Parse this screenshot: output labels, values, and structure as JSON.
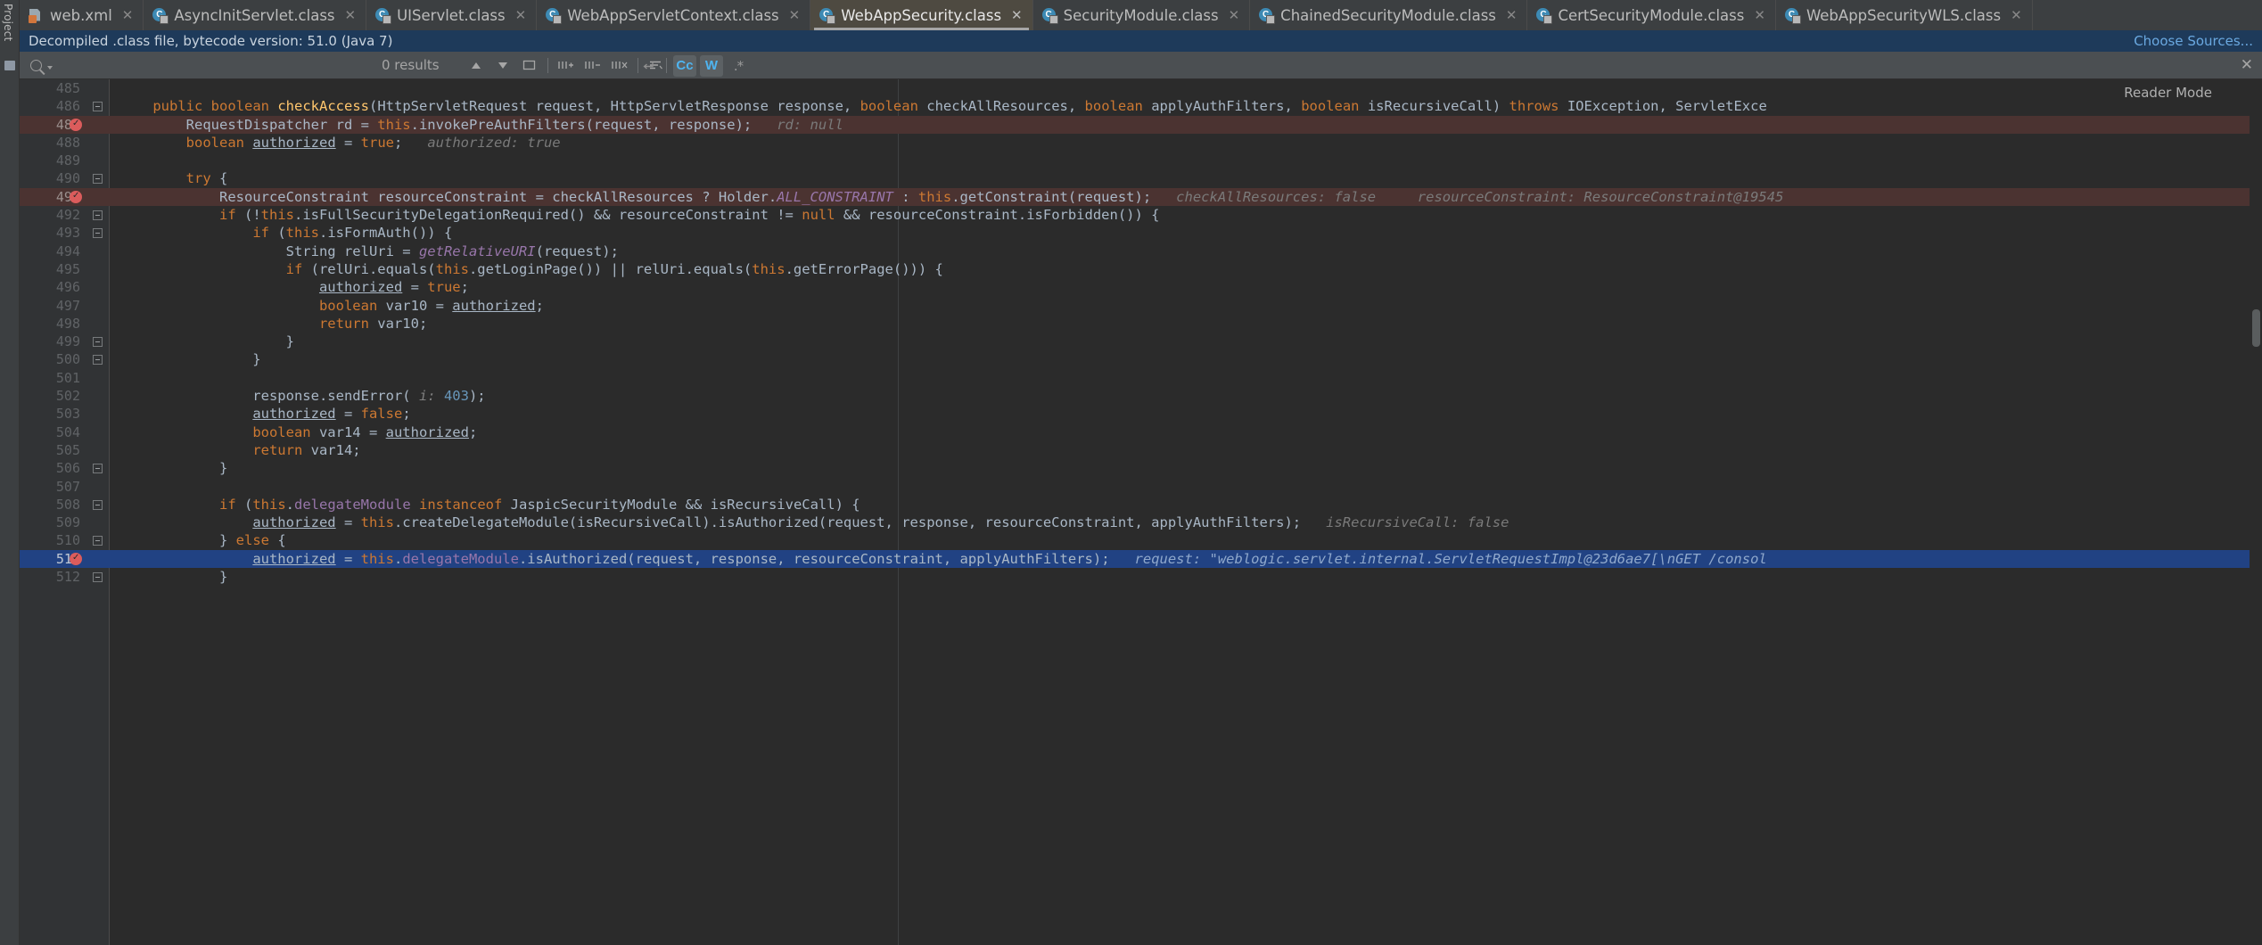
{
  "window": {
    "left_rail_label": "Project"
  },
  "tabs": [
    {
      "label": "web.xml",
      "icon": "xml-file-icon",
      "active": false
    },
    {
      "label": "AsyncInitServlet.class",
      "icon": "java-class-icon",
      "active": false
    },
    {
      "label": "UIServlet.class",
      "icon": "java-class-icon",
      "active": false
    },
    {
      "label": "WebAppServletContext.class",
      "icon": "java-class-icon",
      "active": false
    },
    {
      "label": "WebAppSecurity.class",
      "icon": "java-class-icon",
      "active": true
    },
    {
      "label": "SecurityModule.class",
      "icon": "java-class-icon",
      "active": false
    },
    {
      "label": "ChainedSecurityModule.class",
      "icon": "java-class-icon",
      "active": false
    },
    {
      "label": "CertSecurityModule.class",
      "icon": "java-class-icon",
      "active": false
    },
    {
      "label": "WebAppSecurityWLS.class",
      "icon": "java-class-icon",
      "active": false
    }
  ],
  "notification": {
    "message": "Decompiled .class file, bytecode version: 51.0 (Java 7)",
    "action_label": "Choose Sources...",
    "background": "#1e3a5a",
    "link_color": "#6aa8e0"
  },
  "findbar": {
    "search_value": "",
    "search_placeholder": "",
    "results_label": "0 results",
    "toggles": [
      {
        "name": "match-case",
        "label": "Cc",
        "on": true
      },
      {
        "name": "words",
        "label": "W",
        "on": true
      },
      {
        "name": "regex",
        "label": ".*",
        "on": false
      }
    ],
    "icons": [
      "new-line-icon",
      "prev-occurrence-icon",
      "next-occurrence-icon",
      "select-all-occurrences-icon",
      "add-selection-icon",
      "exclude-selection-icon",
      "exclude-all-icon",
      "filter-lines-icon",
      "filter-icon",
      "close-icon"
    ]
  },
  "editor": {
    "reader_mode_label": "Reader Mode",
    "accent_execution_line": "#4b3331",
    "accent_selected_line": "#214283",
    "breakpoint_color": "#db5c5c",
    "lines": [
      {
        "num": "485",
        "breakpoint": false,
        "fold": false,
        "state": "normal",
        "tokens": [
          {
            "t": "",
            "c": "id"
          }
        ]
      },
      {
        "num": "486",
        "breakpoint": false,
        "fold": true,
        "state": "normal",
        "tokens": [
          {
            "t": "    ",
            "c": "id"
          },
          {
            "t": "public",
            "c": "kw"
          },
          {
            "t": " ",
            "c": "id"
          },
          {
            "t": "boolean",
            "c": "kw"
          },
          {
            "t": " ",
            "c": "id"
          },
          {
            "t": "checkAccess",
            "c": "mth"
          },
          {
            "t": "(HttpServletRequest request, HttpServletResponse response, ",
            "c": "id"
          },
          {
            "t": "boolean",
            "c": "kw"
          },
          {
            "t": " checkAllResources, ",
            "c": "id"
          },
          {
            "t": "boolean",
            "c": "kw"
          },
          {
            "t": " applyAuthFilters, ",
            "c": "id"
          },
          {
            "t": "boolean",
            "c": "kw"
          },
          {
            "t": " isRecursiveCall) ",
            "c": "id"
          },
          {
            "t": "throws",
            "c": "kw"
          },
          {
            "t": " IOException, ServletExce",
            "c": "id"
          }
        ]
      },
      {
        "num": "487",
        "breakpoint": true,
        "fold": false,
        "state": "exec",
        "tokens": [
          {
            "t": "        RequestDispatcher rd = ",
            "c": "id"
          },
          {
            "t": "this",
            "c": "kw"
          },
          {
            "t": ".invokePreAuthFilters(request, response);",
            "c": "id"
          },
          {
            "t": "   rd: null",
            "c": "hint"
          }
        ]
      },
      {
        "num": "488",
        "breakpoint": false,
        "fold": false,
        "state": "normal",
        "tokens": [
          {
            "t": "        ",
            "c": "id"
          },
          {
            "t": "boolean",
            "c": "kw"
          },
          {
            "t": " ",
            "c": "id"
          },
          {
            "t": "authorized",
            "c": "und"
          },
          {
            "t": " = ",
            "c": "id"
          },
          {
            "t": "true",
            "c": "kw"
          },
          {
            "t": ";",
            "c": "id"
          },
          {
            "t": "   authorized: true",
            "c": "hint"
          }
        ]
      },
      {
        "num": "489",
        "breakpoint": false,
        "fold": false,
        "state": "normal",
        "tokens": [
          {
            "t": "",
            "c": "id"
          }
        ]
      },
      {
        "num": "490",
        "breakpoint": false,
        "fold": true,
        "state": "normal",
        "tokens": [
          {
            "t": "        ",
            "c": "id"
          },
          {
            "t": "try",
            "c": "kw"
          },
          {
            "t": " {",
            "c": "id"
          }
        ]
      },
      {
        "num": "491",
        "breakpoint": true,
        "fold": false,
        "state": "exec",
        "tokens": [
          {
            "t": "            ResourceConstraint resourceConstraint = checkAllResources ? Holder.",
            "c": "id"
          },
          {
            "t": "ALL_CONSTRAINT",
            "c": "const"
          },
          {
            "t": " : ",
            "c": "id"
          },
          {
            "t": "this",
            "c": "kw"
          },
          {
            "t": ".getConstraint(request);",
            "c": "id"
          },
          {
            "t": "   checkAllResources: false",
            "c": "hint"
          },
          {
            "t": "     resourceConstraint: ResourceConstraint@19545",
            "c": "hint"
          }
        ]
      },
      {
        "num": "492",
        "breakpoint": false,
        "fold": true,
        "state": "normal",
        "tokens": [
          {
            "t": "            ",
            "c": "id"
          },
          {
            "t": "if",
            "c": "kw"
          },
          {
            "t": " (!",
            "c": "id"
          },
          {
            "t": "this",
            "c": "kw"
          },
          {
            "t": ".isFullSecurityDelegationRequired() && resourceConstraint != ",
            "c": "id"
          },
          {
            "t": "null",
            "c": "kw"
          },
          {
            "t": " && resourceConstraint.isForbidden()) {",
            "c": "id"
          }
        ]
      },
      {
        "num": "493",
        "breakpoint": false,
        "fold": true,
        "state": "normal",
        "tokens": [
          {
            "t": "                ",
            "c": "id"
          },
          {
            "t": "if",
            "c": "kw"
          },
          {
            "t": " (",
            "c": "id"
          },
          {
            "t": "this",
            "c": "kw"
          },
          {
            "t": ".isFormAuth()) {",
            "c": "id"
          }
        ]
      },
      {
        "num": "494",
        "breakpoint": false,
        "fold": false,
        "state": "normal",
        "tokens": [
          {
            "t": "                    String relUri = ",
            "c": "id"
          },
          {
            "t": "getRelativeURI",
            "c": "stat"
          },
          {
            "t": "(request);",
            "c": "id"
          }
        ]
      },
      {
        "num": "495",
        "breakpoint": false,
        "fold": false,
        "state": "normal",
        "tokens": [
          {
            "t": "                    ",
            "c": "id"
          },
          {
            "t": "if",
            "c": "kw"
          },
          {
            "t": " (relUri.equals(",
            "c": "id"
          },
          {
            "t": "this",
            "c": "kw"
          },
          {
            "t": ".getLoginPage()) || relUri.equals(",
            "c": "id"
          },
          {
            "t": "this",
            "c": "kw"
          },
          {
            "t": ".getErrorPage())) {",
            "c": "id"
          }
        ]
      },
      {
        "num": "496",
        "breakpoint": false,
        "fold": false,
        "state": "normal",
        "tokens": [
          {
            "t": "                        ",
            "c": "id"
          },
          {
            "t": "authorized",
            "c": "und"
          },
          {
            "t": " = ",
            "c": "id"
          },
          {
            "t": "true",
            "c": "kw"
          },
          {
            "t": ";",
            "c": "id"
          }
        ]
      },
      {
        "num": "497",
        "breakpoint": false,
        "fold": false,
        "state": "normal",
        "tokens": [
          {
            "t": "                        ",
            "c": "id"
          },
          {
            "t": "boolean",
            "c": "kw"
          },
          {
            "t": " var10 = ",
            "c": "id"
          },
          {
            "t": "authorized",
            "c": "und"
          },
          {
            "t": ";",
            "c": "id"
          }
        ]
      },
      {
        "num": "498",
        "breakpoint": false,
        "fold": false,
        "state": "normal",
        "tokens": [
          {
            "t": "                        ",
            "c": "id"
          },
          {
            "t": "return",
            "c": "kw"
          },
          {
            "t": " var10;",
            "c": "id"
          }
        ]
      },
      {
        "num": "499",
        "breakpoint": false,
        "fold": true,
        "state": "normal",
        "tokens": [
          {
            "t": "                    }",
            "c": "id"
          }
        ]
      },
      {
        "num": "500",
        "breakpoint": false,
        "fold": true,
        "state": "normal",
        "tokens": [
          {
            "t": "                }",
            "c": "id"
          }
        ]
      },
      {
        "num": "501",
        "breakpoint": false,
        "fold": false,
        "state": "normal",
        "tokens": [
          {
            "t": "",
            "c": "id"
          }
        ]
      },
      {
        "num": "502",
        "breakpoint": false,
        "fold": false,
        "state": "normal",
        "tokens": [
          {
            "t": "                response.sendError( ",
            "c": "id"
          },
          {
            "t": "i:",
            "c": "hintv"
          },
          {
            "t": " ",
            "c": "id"
          },
          {
            "t": "403",
            "c": "num2"
          },
          {
            "t": ");",
            "c": "id"
          }
        ]
      },
      {
        "num": "503",
        "breakpoint": false,
        "fold": false,
        "state": "normal",
        "tokens": [
          {
            "t": "                ",
            "c": "id"
          },
          {
            "t": "authorized",
            "c": "und"
          },
          {
            "t": " = ",
            "c": "id"
          },
          {
            "t": "false",
            "c": "kw"
          },
          {
            "t": ";",
            "c": "id"
          }
        ]
      },
      {
        "num": "504",
        "breakpoint": false,
        "fold": false,
        "state": "normal",
        "tokens": [
          {
            "t": "                ",
            "c": "id"
          },
          {
            "t": "boolean",
            "c": "kw"
          },
          {
            "t": " var14 = ",
            "c": "id"
          },
          {
            "t": "authorized",
            "c": "und"
          },
          {
            "t": ";",
            "c": "id"
          }
        ]
      },
      {
        "num": "505",
        "breakpoint": false,
        "fold": false,
        "state": "normal",
        "tokens": [
          {
            "t": "                ",
            "c": "id"
          },
          {
            "t": "return",
            "c": "kw"
          },
          {
            "t": " var14;",
            "c": "id"
          }
        ]
      },
      {
        "num": "506",
        "breakpoint": false,
        "fold": true,
        "state": "normal",
        "tokens": [
          {
            "t": "            }",
            "c": "id"
          }
        ]
      },
      {
        "num": "507",
        "breakpoint": false,
        "fold": false,
        "state": "normal",
        "tokens": [
          {
            "t": "",
            "c": "id"
          }
        ]
      },
      {
        "num": "508",
        "breakpoint": false,
        "fold": true,
        "state": "normal",
        "tokens": [
          {
            "t": "            ",
            "c": "id"
          },
          {
            "t": "if",
            "c": "kw"
          },
          {
            "t": " (",
            "c": "id"
          },
          {
            "t": "this",
            "c": "kw"
          },
          {
            "t": ".",
            "c": "id"
          },
          {
            "t": "delegateModule",
            "c": "fld"
          },
          {
            "t": " ",
            "c": "id"
          },
          {
            "t": "instanceof",
            "c": "kw"
          },
          {
            "t": " JaspicSecurityModule && isRecursiveCall) {",
            "c": "id"
          }
        ]
      },
      {
        "num": "509",
        "breakpoint": false,
        "fold": false,
        "state": "normal",
        "tokens": [
          {
            "t": "                ",
            "c": "id"
          },
          {
            "t": "authorized",
            "c": "und"
          },
          {
            "t": " = ",
            "c": "id"
          },
          {
            "t": "this",
            "c": "kw"
          },
          {
            "t": ".createDelegateModule(isRecursiveCall).isAuthorized(request, response, resourceConstraint, applyAuthFilters);",
            "c": "id"
          },
          {
            "t": "   isRecursiveCall: false",
            "c": "hint"
          }
        ]
      },
      {
        "num": "510",
        "breakpoint": false,
        "fold": true,
        "state": "normal",
        "tokens": [
          {
            "t": "            } ",
            "c": "id"
          },
          {
            "t": "else",
            "c": "kw"
          },
          {
            "t": " {",
            "c": "id"
          }
        ]
      },
      {
        "num": "511",
        "breakpoint": true,
        "fold": false,
        "state": "sel",
        "tokens": [
          {
            "t": "                ",
            "c": "id"
          },
          {
            "t": "authorized",
            "c": "und"
          },
          {
            "t": " = ",
            "c": "id"
          },
          {
            "t": "this",
            "c": "kw"
          },
          {
            "t": ".",
            "c": "id"
          },
          {
            "t": "delegateModule",
            "c": "fld"
          },
          {
            "t": ".isAuthorized(request, response, resourceConstraint, applyAuthFilters);",
            "c": "id"
          },
          {
            "t": "   request: \"weblogic.servlet.internal.ServletRequestImpl@23d6ae7[\\nGET /consol",
            "c": "selhint"
          }
        ]
      },
      {
        "num": "512",
        "breakpoint": false,
        "fold": true,
        "state": "normal",
        "tokens": [
          {
            "t": "            }",
            "c": "id"
          }
        ]
      }
    ]
  }
}
